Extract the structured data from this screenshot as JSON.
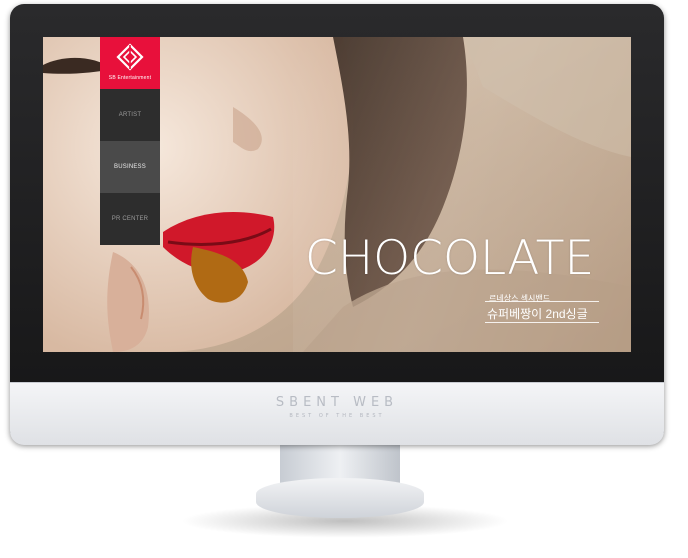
{
  "chin": {
    "brand": "SBENT WEB",
    "tagline": "BEST OF THE BEST"
  },
  "logo": {
    "name": "SB Entertainment"
  },
  "nav": {
    "items": [
      {
        "label": "ARTIST",
        "active": false
      },
      {
        "label": "BUSINESS",
        "active": true
      },
      {
        "label": "PR CENTER",
        "active": false
      }
    ]
  },
  "hero": {
    "title": "CHOCOLATE",
    "subtitle_small": "르네상스 섹시밴드",
    "subtitle_big": "슈퍼베짱이 2nd싱글"
  },
  "colors": {
    "brand": "#e8103b",
    "nav_bg": "#2d2d2d",
    "nav_active": "#4a4a4a"
  }
}
